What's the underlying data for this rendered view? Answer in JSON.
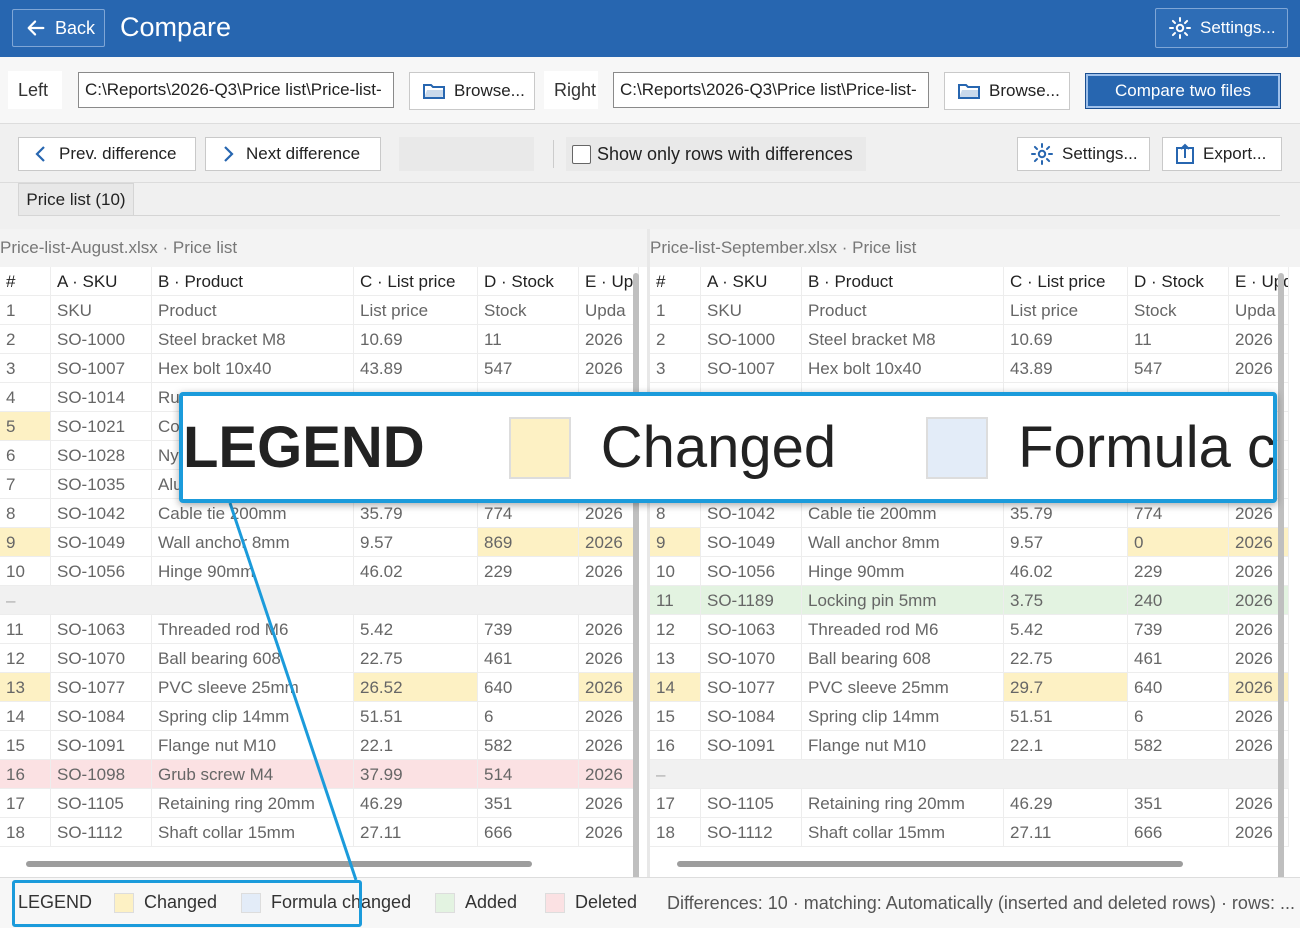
{
  "titlebar": {
    "back_label": "Back",
    "title": "Compare",
    "settings_label": "Settings..."
  },
  "files": {
    "left_label": "Left",
    "left_path": "C:\\Reports\\2026-Q3\\Price list\\Price-list-",
    "browse_label": "Browse...",
    "right_label": "Right",
    "right_path": "C:\\Reports\\2026-Q3\\Price list\\Price-list-",
    "compare_label": "Compare two files"
  },
  "toolbar": {
    "prev_label": "Prev. difference",
    "next_label": "Next difference",
    "only_diff_label": "Show only rows with differences",
    "settings_label": "Settings...",
    "export_label": "Export..."
  },
  "tab": {
    "label": "Price list (10)"
  },
  "left_pane": {
    "caption": "Price-list-August.xlsx · Price list",
    "headers": [
      "#",
      "A · SKU",
      "B · Product",
      "C · List price",
      "D · Stock",
      "E · Upd"
    ],
    "rows": [
      {
        "cells": [
          "1",
          "SKU",
          "Product",
          "List price",
          "Stock",
          "Upda"
        ],
        "state": "",
        "changed": []
      },
      {
        "cells": [
          "2",
          "SO-1000",
          "Steel bracket M8",
          "10.69",
          "11",
          "2026"
        ],
        "state": "",
        "changed": []
      },
      {
        "cells": [
          "3",
          "SO-1007",
          "Hex bolt 10x40",
          "43.89",
          "547",
          "2026"
        ],
        "state": "",
        "changed": []
      },
      {
        "cells": [
          "4",
          "SO-1014",
          "Ru",
          "",
          "",
          ""
        ],
        "state": "",
        "changed": []
      },
      {
        "cells": [
          "5",
          "SO-1021",
          "Co",
          "",
          "",
          ""
        ],
        "state": "",
        "changed": [
          0
        ]
      },
      {
        "cells": [
          "6",
          "SO-1028",
          "Ny",
          "",
          "",
          ""
        ],
        "state": "",
        "changed": []
      },
      {
        "cells": [
          "7",
          "SO-1035",
          "Alu",
          "",
          "",
          ""
        ],
        "state": "",
        "changed": []
      },
      {
        "cells": [
          "8",
          "SO-1042",
          "Cable tie 200mm",
          "35.79",
          "774",
          "2026"
        ],
        "state": "",
        "changed": []
      },
      {
        "cells": [
          "9",
          "SO-1049",
          "Wall anchor 8mm",
          "9.57",
          "869",
          "2026"
        ],
        "state": "",
        "changed": [
          0,
          4,
          5
        ]
      },
      {
        "cells": [
          "10",
          "SO-1056",
          "Hinge 90mm",
          "46.02",
          "229",
          "2026"
        ],
        "state": "",
        "changed": []
      },
      {
        "cells": [
          "–",
          "",
          "",
          "",
          "",
          ""
        ],
        "state": "gap",
        "changed": []
      },
      {
        "cells": [
          "11",
          "SO-1063",
          "Threaded rod M6",
          "5.42",
          "739",
          "2026"
        ],
        "state": "",
        "changed": []
      },
      {
        "cells": [
          "12",
          "SO-1070",
          "Ball bearing 608",
          "22.75",
          "461",
          "2026"
        ],
        "state": "",
        "changed": []
      },
      {
        "cells": [
          "13",
          "SO-1077",
          "PVC sleeve 25mm",
          "26.52",
          "640",
          "2026"
        ],
        "state": "",
        "changed": [
          0,
          3,
          5
        ]
      },
      {
        "cells": [
          "14",
          "SO-1084",
          "Spring clip 14mm",
          "51.51",
          "6",
          "2026"
        ],
        "state": "",
        "changed": []
      },
      {
        "cells": [
          "15",
          "SO-1091",
          "Flange nut M10",
          "22.1",
          "582",
          "2026"
        ],
        "state": "",
        "changed": []
      },
      {
        "cells": [
          "16",
          "SO-1098",
          "Grub screw M4",
          "37.99",
          "514",
          "2026"
        ],
        "state": "deleted",
        "changed": []
      },
      {
        "cells": [
          "17",
          "SO-1105",
          "Retaining ring 20mm",
          "46.29",
          "351",
          "2026"
        ],
        "state": "",
        "changed": []
      },
      {
        "cells": [
          "18",
          "SO-1112",
          "Shaft collar 15mm",
          "27.11",
          "666",
          "2026"
        ],
        "state": "",
        "changed": []
      }
    ]
  },
  "right_pane": {
    "caption": "Price-list-September.xlsx · Price list",
    "headers": [
      "#",
      "A · SKU",
      "B · Product",
      "C · List price",
      "D · Stock",
      "E · Upd"
    ],
    "rows": [
      {
        "cells": [
          "1",
          "SKU",
          "Product",
          "List price",
          "Stock",
          "Upda"
        ],
        "state": "",
        "changed": []
      },
      {
        "cells": [
          "2",
          "SO-1000",
          "Steel bracket M8",
          "10.69",
          "11",
          "2026"
        ],
        "state": "",
        "changed": []
      },
      {
        "cells": [
          "3",
          "SO-1007",
          "Hex bolt 10x40",
          "43.89",
          "547",
          "2026"
        ],
        "state": "",
        "changed": []
      },
      {
        "cells": [
          "",
          "",
          "",
          "",
          "",
          ""
        ],
        "state": "",
        "changed": []
      },
      {
        "cells": [
          "",
          "",
          "",
          "",
          "",
          ""
        ],
        "state": "",
        "changed": []
      },
      {
        "cells": [
          "",
          "",
          "",
          "",
          "",
          ""
        ],
        "state": "",
        "changed": []
      },
      {
        "cells": [
          "",
          "",
          "",
          "",
          "",
          ""
        ],
        "state": "",
        "changed": []
      },
      {
        "cells": [
          "8",
          "SO-1042",
          "Cable tie 200mm",
          "35.79",
          "774",
          "2026"
        ],
        "state": "",
        "changed": []
      },
      {
        "cells": [
          "9",
          "SO-1049",
          "Wall anchor 8mm",
          "9.57",
          "0",
          "2026"
        ],
        "state": "",
        "changed": [
          0,
          4,
          5
        ]
      },
      {
        "cells": [
          "10",
          "SO-1056",
          "Hinge 90mm",
          "46.02",
          "229",
          "2026"
        ],
        "state": "",
        "changed": []
      },
      {
        "cells": [
          "11",
          "SO-1189",
          "Locking pin 5mm",
          "3.75",
          "240",
          "2026"
        ],
        "state": "added",
        "changed": []
      },
      {
        "cells": [
          "12",
          "SO-1063",
          "Threaded rod M6",
          "5.42",
          "739",
          "2026"
        ],
        "state": "",
        "changed": []
      },
      {
        "cells": [
          "13",
          "SO-1070",
          "Ball bearing 608",
          "22.75",
          "461",
          "2026"
        ],
        "state": "",
        "changed": []
      },
      {
        "cells": [
          "14",
          "SO-1077",
          "PVC sleeve 25mm",
          "29.7",
          "640",
          "2026"
        ],
        "state": "",
        "changed": [
          0,
          3,
          5
        ]
      },
      {
        "cells": [
          "15",
          "SO-1084",
          "Spring clip 14mm",
          "51.51",
          "6",
          "2026"
        ],
        "state": "",
        "changed": []
      },
      {
        "cells": [
          "16",
          "SO-1091",
          "Flange nut M10",
          "22.1",
          "582",
          "2026"
        ],
        "state": "",
        "changed": []
      },
      {
        "cells": [
          "–",
          "",
          "",
          "",
          "",
          ""
        ],
        "state": "gap",
        "changed": []
      },
      {
        "cells": [
          "17",
          "SO-1105",
          "Retaining ring 20mm",
          "46.29",
          "351",
          "2026"
        ],
        "state": "",
        "changed": []
      },
      {
        "cells": [
          "18",
          "SO-1112",
          "Shaft collar 15mm",
          "27.11",
          "666",
          "2026"
        ],
        "state": "",
        "changed": []
      }
    ]
  },
  "legend": {
    "title": "LEGEND",
    "changed": "Changed",
    "formula": "Formula changed",
    "added": "Added",
    "deleted": "Deleted",
    "colors": {
      "changed": "#fdf1c4",
      "formula": "#e3ecf8",
      "added": "#e3f3e1",
      "deleted": "#fbe1e3"
    }
  },
  "status": {
    "text": "Differences: 10 · matching: Automatically (inserted and deleted rows) · rows: ..."
  },
  "magnifier": {
    "title": "LEGEND",
    "changed": "Changed",
    "formula": "Formula ch"
  },
  "colors": {
    "accent": "#2766b0",
    "highlight": "#1b9bdb"
  }
}
